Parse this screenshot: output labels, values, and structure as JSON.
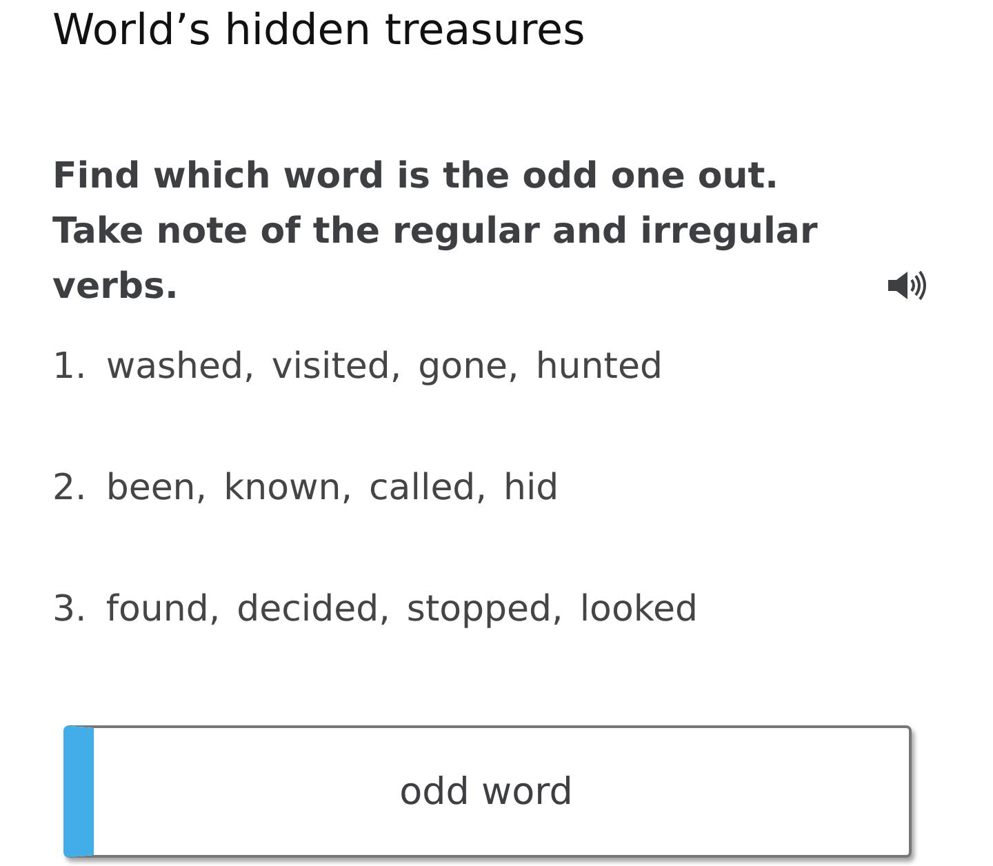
{
  "title": "World’s hidden treasures",
  "instruction": "Find which word is the odd one out. Take note of the regular and irregular verbs.",
  "items": [
    {
      "number": "1.",
      "words": [
        "washed,",
        "visited,",
        "gone,",
        "hunted"
      ]
    },
    {
      "number": "2.",
      "words": [
        "been,",
        "known,",
        "called,",
        "hid"
      ]
    },
    {
      "number": "3.",
      "words": [
        "found,",
        "decided,",
        "stopped,",
        "looked"
      ]
    }
  ],
  "answer_card": {
    "label": "odd word"
  }
}
